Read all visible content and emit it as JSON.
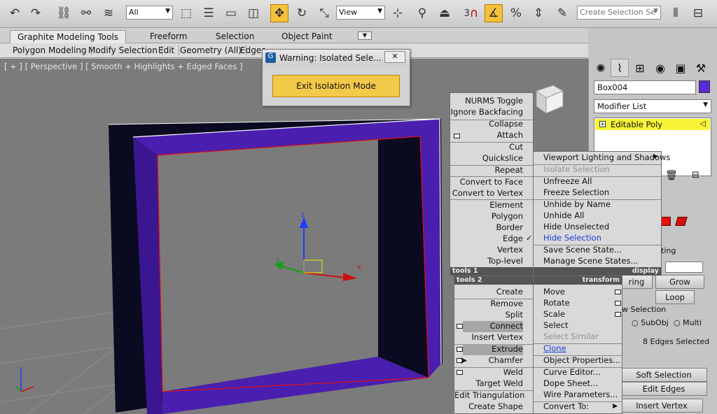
{
  "toolbar": {
    "filter_value": "All",
    "refcoord_value": "View",
    "selection_set_placeholder": "Create Selection Se",
    "snap_label": "3",
    "icons": [
      "undo-icon",
      "redo-icon",
      "link-icon",
      "unlink-icon",
      "bind-spacewarp-icon",
      "select-object-icon",
      "select-by-name-icon",
      "rect-selection-icon",
      "window-crossing-icon",
      "select-move-icon",
      "select-rotate-icon",
      "select-scale-icon",
      "pivot-icon",
      "manipulate-icon",
      "keyboard-shortcut-icon",
      "snaps-toggle-icon",
      "angle-snap-icon",
      "percent-snap-icon",
      "spinner-snap-icon",
      "edit-named-selection-icon",
      "mirror-icon",
      "align-icon"
    ]
  },
  "ribbon": {
    "tabs": [
      "Graphite Modeling Tools",
      "Freeform",
      "Selection",
      "Object Paint"
    ],
    "panels": [
      "Polygon Modeling",
      "Modify Selection",
      "Edit",
      "Geometry (All)",
      "Edges"
    ]
  },
  "viewport": {
    "label": "[ + ] [ Perspective ] [ Smooth + Highlights + Edged Faces ]",
    "axis_x": "x",
    "axis_y": "y",
    "axis_z": "z"
  },
  "isolate_dialog": {
    "title": "Warning: Isolated Sele...",
    "button": "Exit Isolation Mode"
  },
  "quad_tools1": {
    "items": [
      "NURMS Toggle",
      "Ignore Backfacing",
      "Collapse",
      "Attach",
      "Cut",
      "Quickslice",
      "Repeat",
      "Convert to Face",
      "Convert to Vertex",
      "Element",
      "Polygon",
      "Border",
      "Edge",
      "Vertex",
      "Top-level"
    ],
    "footer_left": "tools 1",
    "footer_right": "display"
  },
  "quad_display": {
    "items": [
      "Viewport Lighting and Shadows",
      "Isolate Selection",
      "Unfreeze All",
      "Freeze Selection",
      "Unhide by Name",
      "Unhide All",
      "Hide Unselected",
      "Hide Selection",
      "Save Scene State...",
      "Manage Scene States..."
    ]
  },
  "quad_tools2": {
    "header": "tools 2",
    "items": [
      "Create",
      "Remove",
      "Split",
      "Connect",
      "Insert Vertex",
      "Extrude",
      "Chamfer",
      "Weld",
      "Target Weld",
      "Edit Triangulation",
      "Create Shape"
    ]
  },
  "quad_transform": {
    "header": "transform",
    "items": [
      "Move",
      "Rotate",
      "Scale",
      "Select",
      "Select Similar",
      "Clone",
      "Object Properties...",
      "Curve Editor...",
      "Dope Sheet...",
      "Wire Parameters...",
      "Convert To:"
    ]
  },
  "cmd_panel": {
    "object_name": "Box004",
    "modifier_list": "Modifier List",
    "stack_item": "Editable Poly",
    "grow_button": "Grow",
    "loop_button": "Loop",
    "ring_fragment": "ring",
    "selection_fragment": "w Selection",
    "subobj_label": "SubObj",
    "multi_label": "Multi",
    "edges_selected": "8 Edges Selected",
    "soft_selection": "Soft Selection",
    "edit_edges": "Edit Edges",
    "insert_vertex": "Insert Vertex",
    "ting_fragment": "ting"
  },
  "colors": {
    "accent": "#f3c94a",
    "frame_purple": "#4a1fb0",
    "frame_dark": "#0b0b22",
    "modifier_yellow": "#f7f337",
    "color_swatch": "#5a2bd6"
  }
}
